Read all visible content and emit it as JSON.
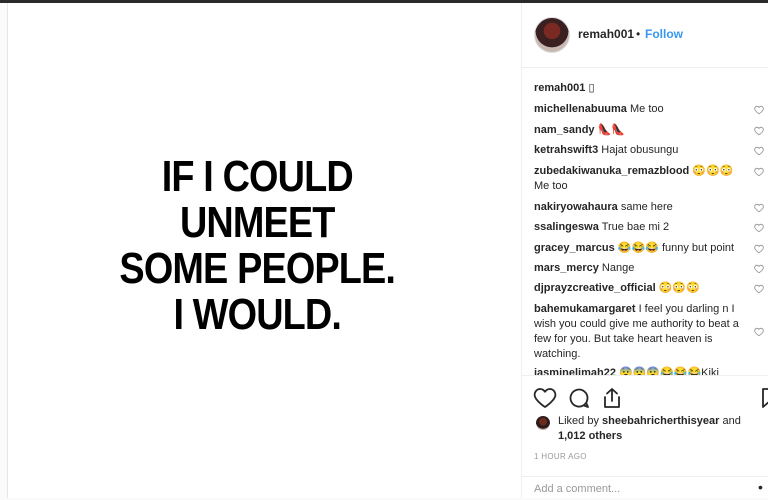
{
  "post": {
    "quote_lines": [
      "IF I COULD",
      "UNMEET",
      "SOME PEOPLE.",
      "I WOULD."
    ]
  },
  "header": {
    "username": "remah001",
    "separator": "•",
    "follow_label": "Follow"
  },
  "caption": {
    "username": "remah001",
    "text": "▯"
  },
  "comments": [
    {
      "user": "michellenabuuma",
      "text": "Me too"
    },
    {
      "user": "nam_sandy",
      "text": "👠👠"
    },
    {
      "user": "ketrahswift3",
      "text": "Hajat obusungu"
    },
    {
      "user": "zubedakiwanuka_remazblood",
      "text": "😳😳😳 Me too"
    },
    {
      "user": "nakiryowahaura",
      "text": "same here"
    },
    {
      "user": "ssalingeswa",
      "text": "True bae mi 2"
    },
    {
      "user": "gracey_marcus",
      "text": "😂😂😂 funny but point"
    },
    {
      "user": "mars_mercy",
      "text": "Nange"
    },
    {
      "user": "djprayzcreative_official",
      "text": "😳😳😳"
    },
    {
      "user": "bahemukamargaret",
      "text": "I feel you darling n I wish you could give me authority to beat a few for you. But take heart heaven is watching."
    },
    {
      "user": "jasminelimah22",
      "text": "😨😨😨😂😂😂Kiki"
    }
  ],
  "likes": {
    "prefix": "Liked by",
    "user": "sheebahricherthisyear",
    "mid": "and",
    "count": "1,012 others"
  },
  "time_ago": "1 HOUR AGO",
  "add_comment": {
    "placeholder": "Add a comment..."
  },
  "more_label": "•",
  "icons": [
    "heart-icon",
    "comment-icon",
    "share-icon",
    "bookmark-icon"
  ]
}
